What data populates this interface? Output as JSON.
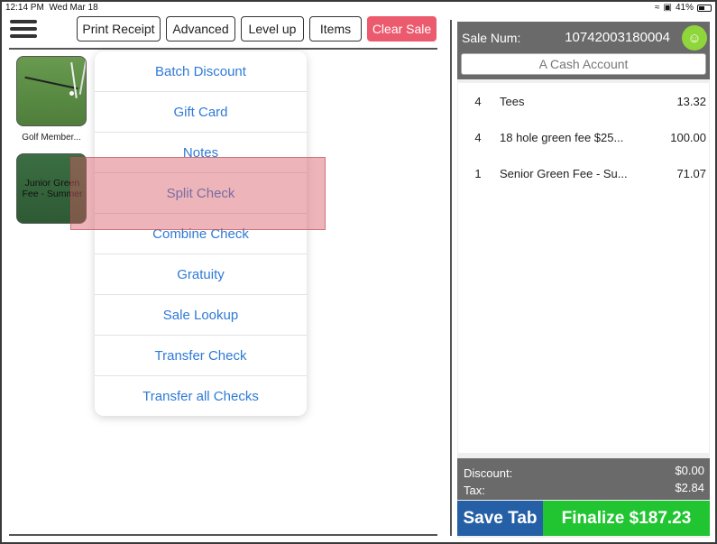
{
  "status_bar": {
    "time": "12:14 PM",
    "date": "Wed Mar 18",
    "battery": "41%",
    "battery_level": 0.41
  },
  "toolbar": {
    "print_receipt": "Print Receipt",
    "advanced": "Advanced",
    "level_up": "Level up",
    "items": "Items",
    "clear_sale": "Clear Sale"
  },
  "tiles": [
    {
      "label": "Golf Member..."
    },
    {
      "label": "Junior Green Fee - Summer"
    }
  ],
  "advanced_menu": {
    "items": [
      {
        "label": "Batch Discount"
      },
      {
        "label": "Gift Card"
      },
      {
        "label": "Notes"
      },
      {
        "label": "Split Check"
      },
      {
        "label": "Combine Check"
      },
      {
        "label": "Gratuity"
      },
      {
        "label": "Sale Lookup"
      },
      {
        "label": "Transfer Check"
      },
      {
        "label": "Transfer all Checks"
      }
    ],
    "highlighted": "Split Check"
  },
  "sale": {
    "label": "Sale Num:",
    "number": "10742003180004",
    "customer": "A Cash Account",
    "lines": [
      {
        "qty": "4",
        "desc": "Tees",
        "price": "13.32"
      },
      {
        "qty": "4",
        "desc": "18 hole green fee $25...",
        "price": "100.00"
      },
      {
        "qty": "1",
        "desc": "Senior Green Fee - Su...",
        "price": "71.07"
      }
    ],
    "discount_label": "Discount:",
    "discount_value": "$0.00",
    "tax_label": "Tax:",
    "tax_value": "$2.84"
  },
  "actions": {
    "save_tab": "Save Tab",
    "finalize": "Finalize $187.23"
  },
  "colors": {
    "clear_sale": "#ec5a6e",
    "menu_link": "#2f7ad6",
    "panel_header": "#6a6a6a",
    "save_tab": "#2560a6",
    "finalize": "#21c531",
    "add_customer": "#8fd63a",
    "highlight": "#d65a64"
  }
}
